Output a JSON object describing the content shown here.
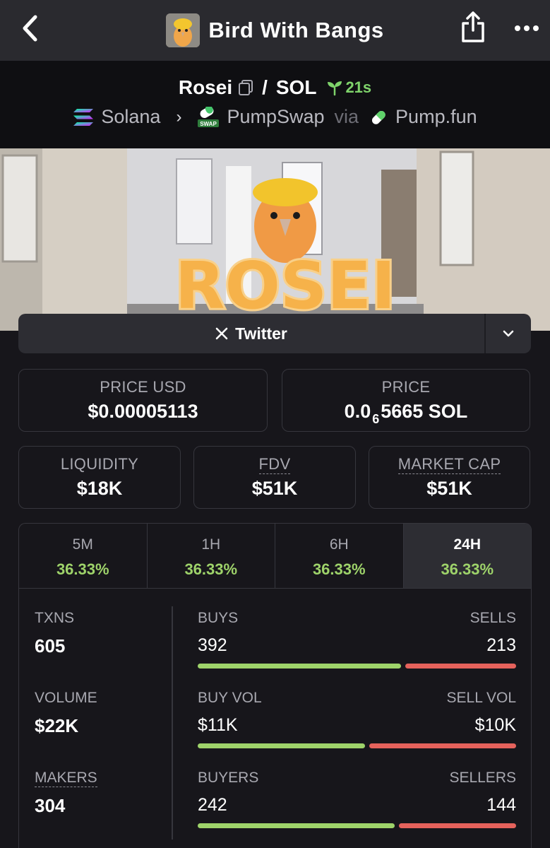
{
  "nav": {
    "title": "Bird With Bangs",
    "back_icon": "chevron-left-icon",
    "share_icon": "share-icon",
    "more_icon": "more-dots-icon"
  },
  "pair": {
    "base": "Rosei",
    "separator": "/",
    "quote": "SOL",
    "age": "21s",
    "chain": "Solana",
    "dex": "PumpSwap",
    "via": "via",
    "launchpad": "Pump.fun"
  },
  "banner": {
    "word": "ROSEI"
  },
  "links": {
    "twitter_label": "Twitter"
  },
  "stats": {
    "price_usd_label": "PRICE USD",
    "price_usd_value": "$0.00005113",
    "price_label": "PRICE",
    "price_prefix": "0.0",
    "price_zeros": "6",
    "price_suffix": "5665 SOL",
    "liquidity_label": "LIQUIDITY",
    "liquidity_value": "$18K",
    "fdv_label": "FDV",
    "fdv_value": "$51K",
    "mcap_label": "MARKET CAP",
    "mcap_value": "$51K"
  },
  "tabs": [
    {
      "label": "5M",
      "value": "36.33%"
    },
    {
      "label": "1H",
      "value": "36.33%"
    },
    {
      "label": "6H",
      "value": "36.33%"
    },
    {
      "label": "24H",
      "value": "36.33%",
      "active": true
    }
  ],
  "txns": {
    "txns_label": "TXNS",
    "txns_value": "605",
    "volume_label": "VOLUME",
    "volume_value": "$22K",
    "makers_label": "MAKERS",
    "makers_value": "304",
    "rows": [
      {
        "left_label": "BUYS",
        "right_label": "SELLS",
        "left_value": "392",
        "right_value": "213",
        "buy_share": 0.648
      },
      {
        "left_label": "BUY VOL",
        "right_label": "SELL VOL",
        "left_value": "$11K",
        "right_value": "$10K",
        "buy_share": 0.532
      },
      {
        "left_label": "BUYERS",
        "right_label": "SELLERS",
        "left_value": "242",
        "right_value": "144",
        "buy_share": 0.627
      }
    ]
  },
  "colors": {
    "buy": "#9ed36a",
    "sell": "#e5625c",
    "age": "#7fd36b"
  }
}
